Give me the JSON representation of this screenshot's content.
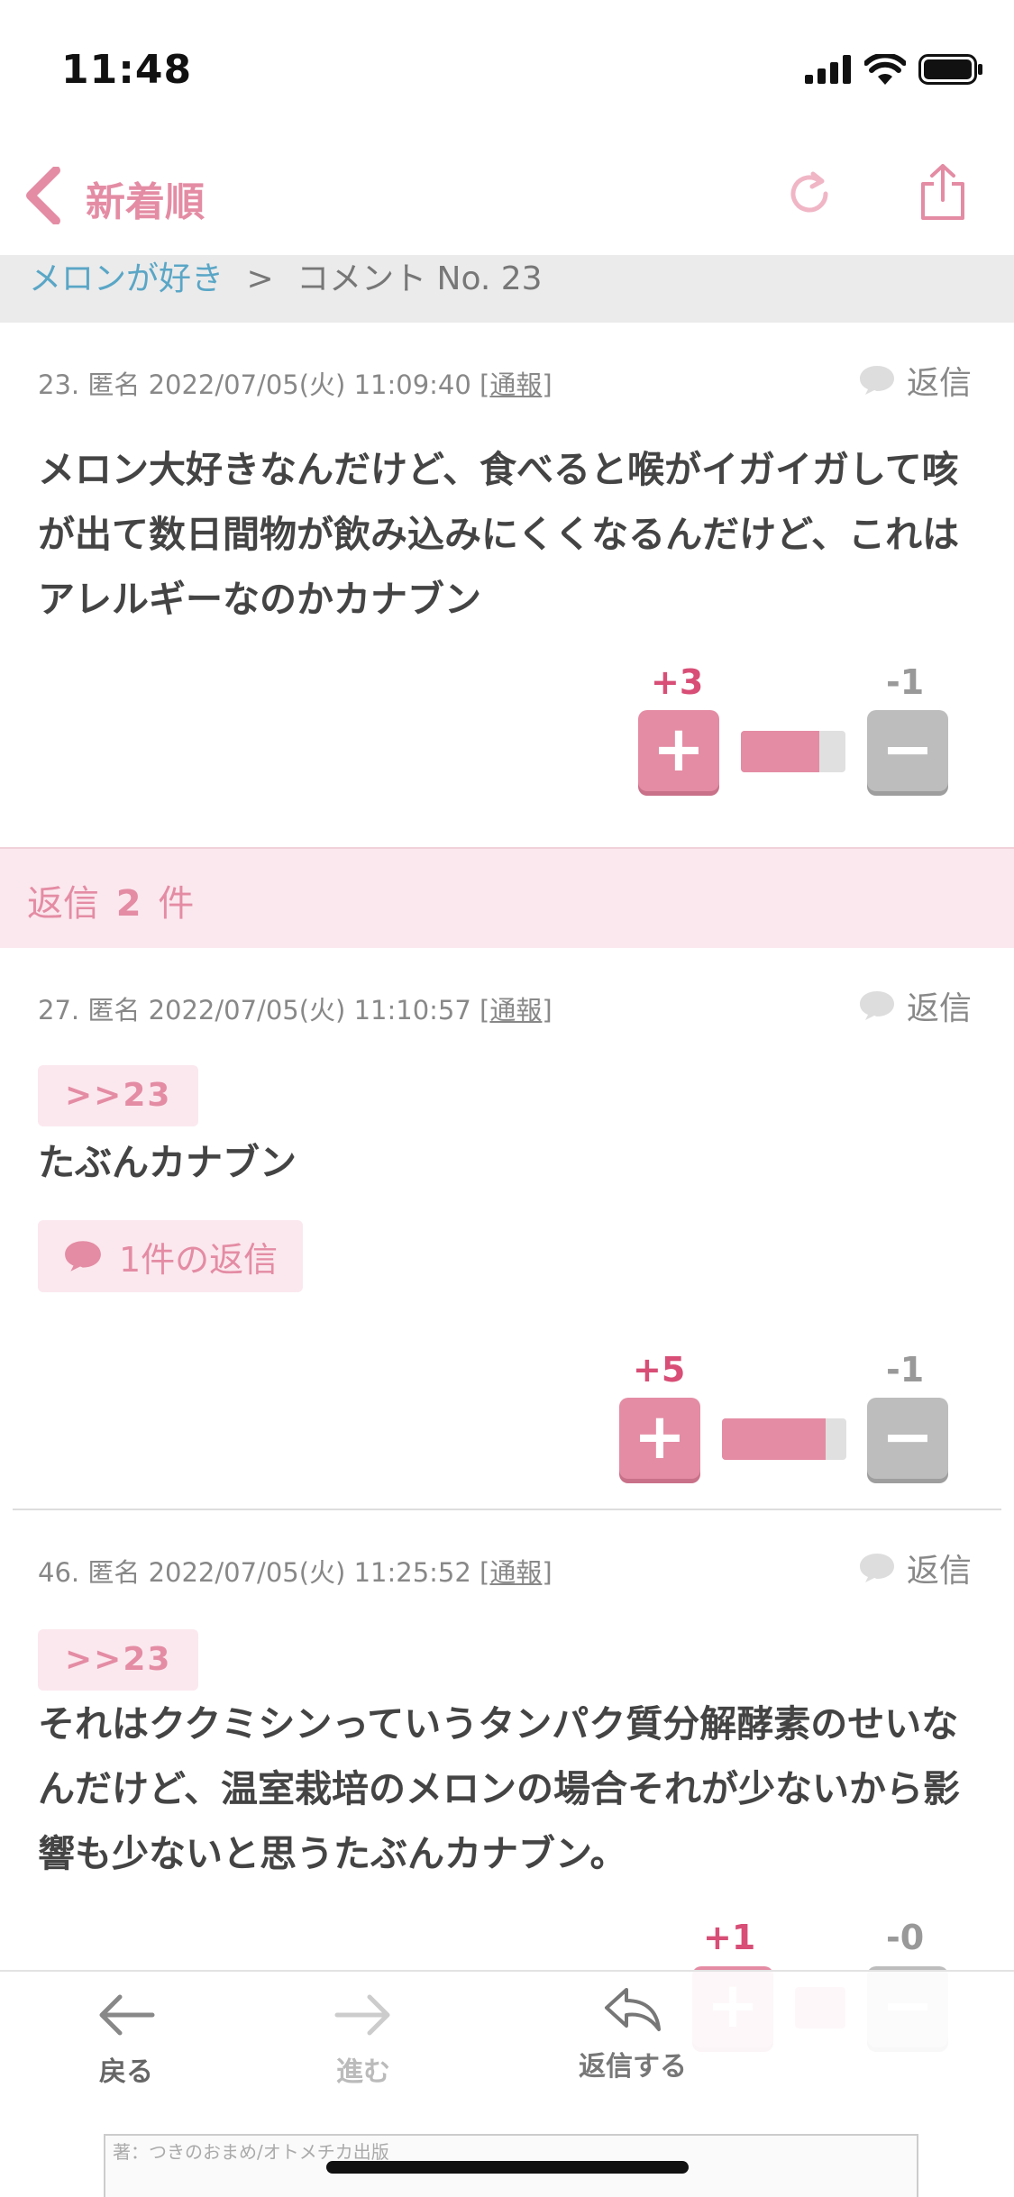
{
  "status_bar": {
    "time": "11:48"
  },
  "nav": {
    "back_label": "新着順"
  },
  "breadcrumb": {
    "link": "メロンが好き",
    "separator": ">",
    "current": "コメント No. 23"
  },
  "comments": [
    {
      "number": "23.",
      "name": "匿名",
      "datetime": "2022/07/05(火) 11:09:40",
      "report": "通報",
      "reply_label": "返信",
      "anchor": "",
      "body": "メロン大好きなんだけど、食べると喉がイガイガして咳が出て数日間物が飲み込みにくくなるんだけど、これはアレルギーなのかカナブン",
      "plus": "+3",
      "minus": "-1",
      "ratio": 0.75
    },
    {
      "number": "27.",
      "name": "匿名",
      "datetime": "2022/07/05(火) 11:10:57",
      "report": "通報",
      "reply_label": "返信",
      "anchor": ">>23",
      "body": "たぶんカナブン",
      "replies_button": "1件の返信",
      "plus": "+5",
      "minus": "-1",
      "ratio": 0.83
    },
    {
      "number": "46.",
      "name": "匿名",
      "datetime": "2022/07/05(火) 11:25:52",
      "report": "通報",
      "reply_label": "返信",
      "anchor": ">>23",
      "body": "それはククミシンっていうタンパク質分解酵素のせいなんだけど、温室栽培のメロンの場合それが少ないから影響も少ないと思うたぶんカナブン。",
      "plus": "+1",
      "minus": "-0",
      "ratio": 1.0
    }
  ],
  "reply_header": {
    "prefix": "返信",
    "count": "2",
    "suffix": "件"
  },
  "toolbar": {
    "back": "戻る",
    "forward": "進む",
    "reply": "返信する"
  },
  "ad": {
    "credit": "著：つきのおまめ/オトメチカ出版"
  },
  "colors": {
    "accent": "#e48ca4",
    "link": "#5aa6c6",
    "plus_text": "#d84e76"
  }
}
